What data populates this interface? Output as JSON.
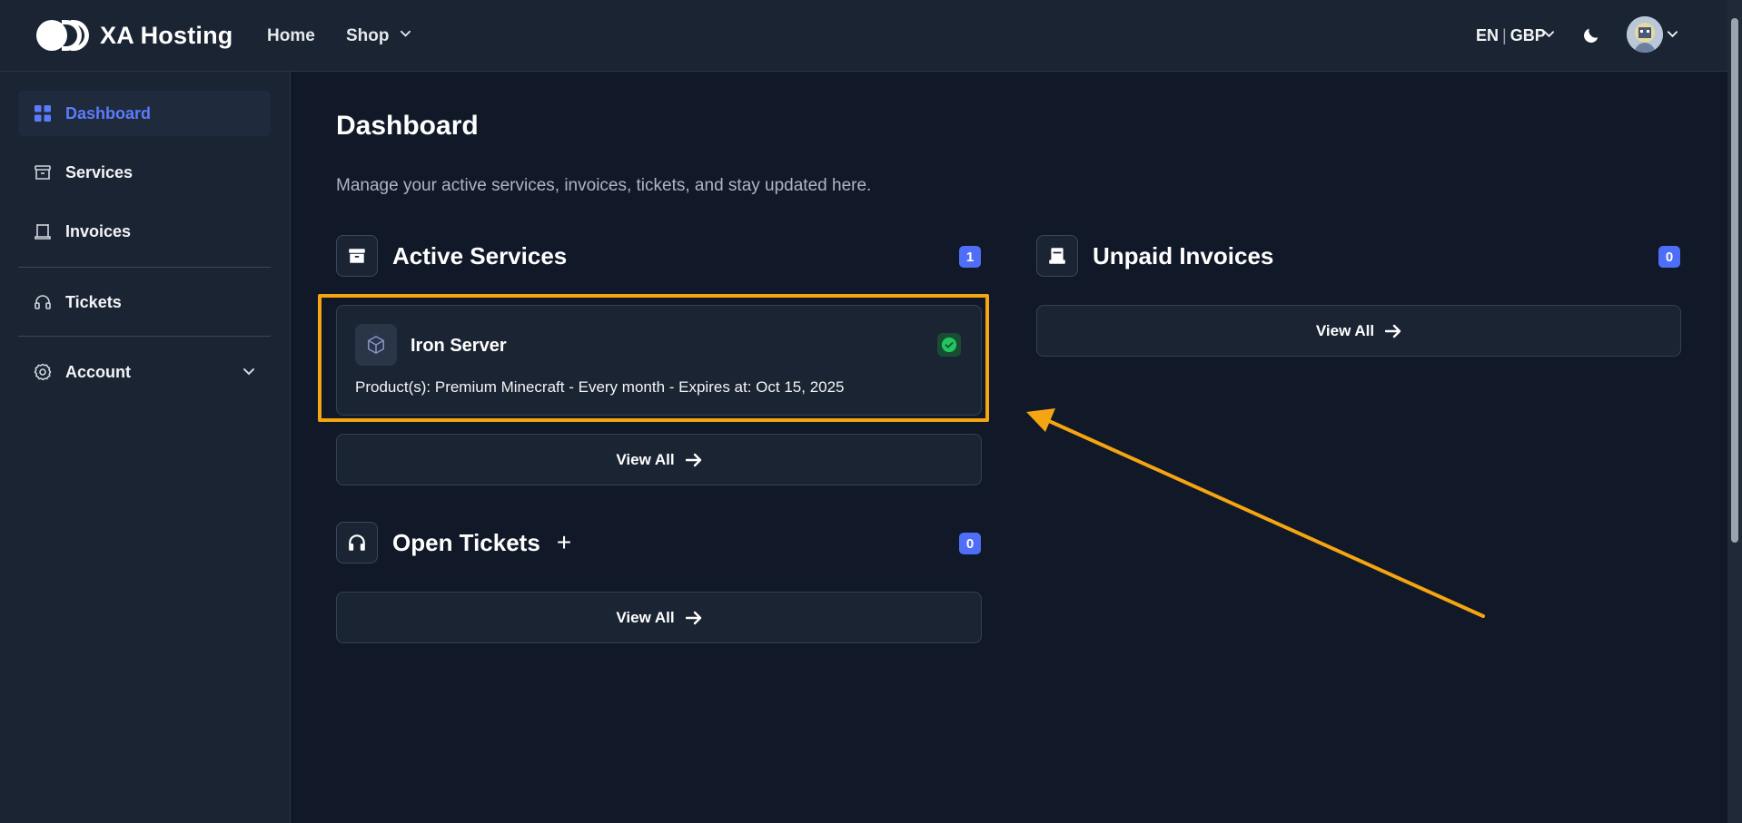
{
  "header": {
    "brand": "XA Hosting",
    "nav": {
      "home": "Home",
      "shop": "Shop"
    },
    "language": "EN",
    "currency": "GBP",
    "icons": [
      "logo-icon",
      "chevron-down-icon",
      "moon-icon",
      "avatar"
    ]
  },
  "sidebar": {
    "items": [
      {
        "label": "Dashboard",
        "icon": "grid-icon",
        "active": true
      },
      {
        "label": "Services",
        "icon": "archive-icon"
      },
      {
        "label": "Invoices",
        "icon": "receipt-icon"
      },
      {
        "label": "Tickets",
        "icon": "headset-icon"
      },
      {
        "label": "Account",
        "icon": "gear-icon"
      }
    ]
  },
  "main": {
    "title": "Dashboard",
    "subtitle": "Manage your active services, invoices, tickets, and stay updated here.",
    "active_services": {
      "title": "Active Services",
      "count": "1",
      "service": {
        "name": "Iron Server",
        "description": "Product(s): Premium Minecraft - Every month - Expires at: Oct 15, 2025",
        "status": "active"
      },
      "view_all": "View All"
    },
    "open_tickets": {
      "title": "Open Tickets",
      "add": "+",
      "count": "0",
      "view_all": "View All"
    },
    "unpaid_invoices": {
      "title": "Unpaid Invoices",
      "count": "0",
      "view_all": "View All"
    }
  },
  "colors": {
    "background": "#111827",
    "panel": "#1b2433",
    "accent": "#4f6ef7",
    "active_link": "#5b7cfa",
    "highlight": "#f5a511",
    "success": "#22c55e"
  }
}
